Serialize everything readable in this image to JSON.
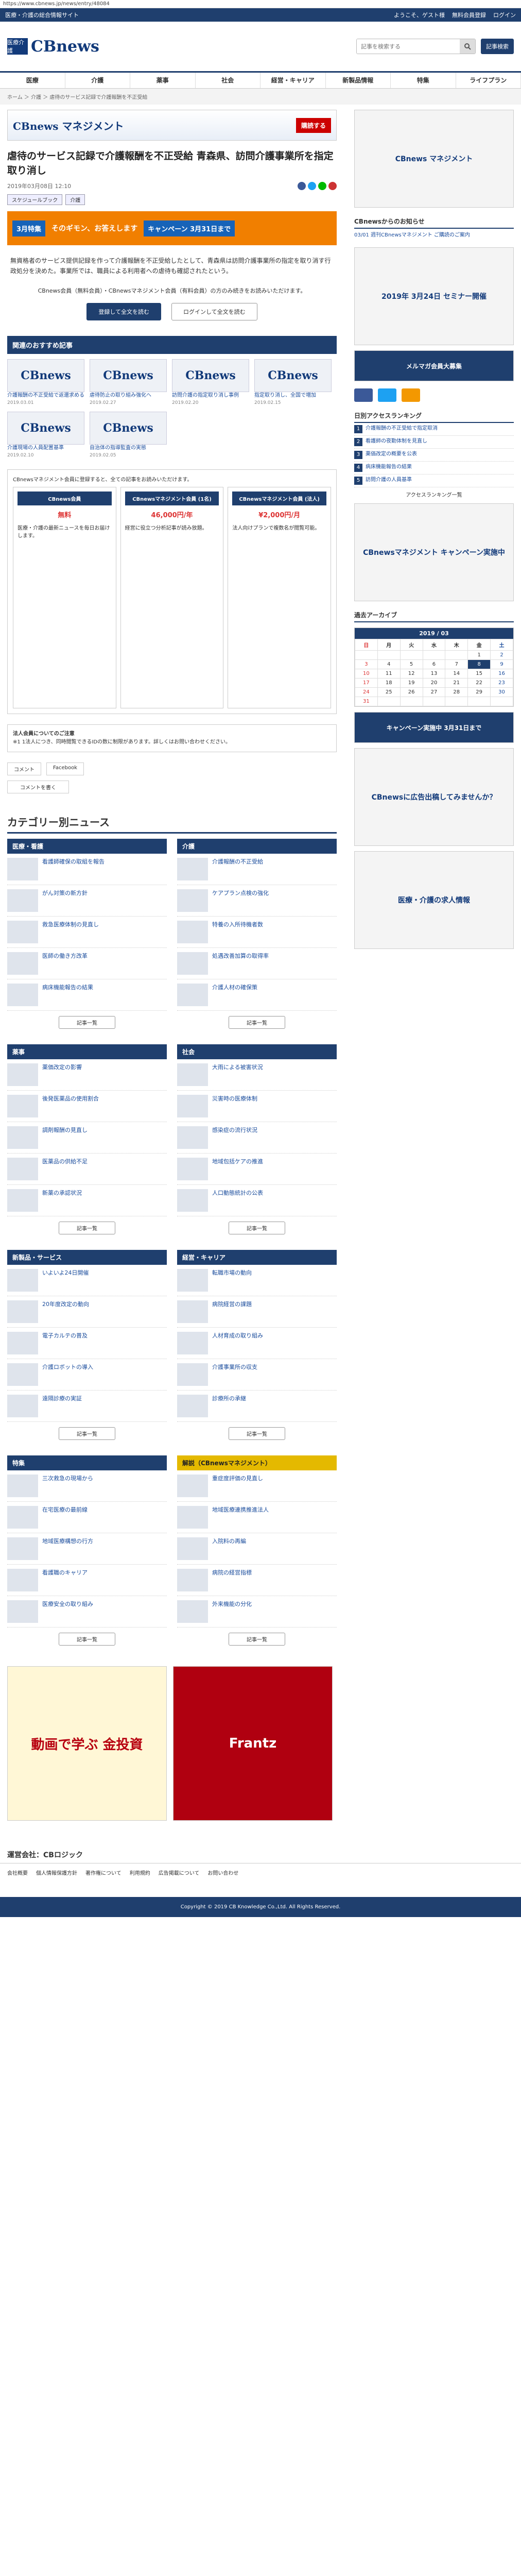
{
  "url": "https://www.cbnews.jp/news/entry/48084",
  "topbar": {
    "left": "医療・介護の総合情報サイト",
    "welcome": "ようこそ、ゲスト様",
    "trial": "無料会員登録",
    "login": "ログイン"
  },
  "logo": {
    "mark": "医療介護",
    "name": "CBnews"
  },
  "search": {
    "placeholder": "記事を検索する",
    "register": "記事検索"
  },
  "nav": [
    "医療",
    "介護",
    "薬事",
    "社会",
    "経営・キャリア",
    "新製品情報",
    "特集",
    "ライフプラン"
  ],
  "breadcrumb": "ホーム ＞ 介護 ＞ 虐待のサービス記録で介護報酬を不正受給",
  "banner": {
    "brand": "CBnews マネジメント",
    "cta": "購読する"
  },
  "article": {
    "title": "虐待のサービス記録で介護報酬を不正受給 青森県、訪問介護事業所を指定取り消し",
    "date": "2019年03月08日 12:10",
    "tags": [
      "スケジュールブック",
      "介護"
    ],
    "lead": "無資格者のサービス提供記録を作って介護報酬を不正受給したとして、青森県は訪問介護事業所の指定を取り消す行政処分を決めた。事業所では、職員による利用者への虐待も確認されたという。",
    "lock_msg": "CBnews会員（無料会員）・CBnewsマネジメント会員（有料会員）の方のみ続きをお読みいただけます。",
    "btn_register": "登録して全文を読む",
    "btn_login": "ログインして全文を読む"
  },
  "strip": {
    "left": "3月特集",
    "mid": "そのギモン、お答えします",
    "right": "キャンペーン 3月31日まで"
  },
  "related_title": "関連のおすすめ記事",
  "related": [
    {
      "label": "介護報酬の不正受給で返還求める",
      "date": "2019.03.01"
    },
    {
      "label": "虐待防止の取り組み強化へ",
      "date": "2019.02.27"
    },
    {
      "label": "訪問介護の指定取り消し事例",
      "date": "2019.02.20"
    },
    {
      "label": "指定取り消し、全国で増加",
      "date": "2019.02.15"
    },
    {
      "label": "介護現場の人員配置基準",
      "date": "2019.02.10"
    },
    {
      "label": "自治体の指導監査の実態",
      "date": "2019.02.05"
    }
  ],
  "plans": {
    "intro": "CBnewsマネジメント会員に登録すると、全ての記事をお読みいただけます。",
    "cols": [
      {
        "head": "CBnews会員",
        "price": "無料",
        "body": "医療・介護の最新ニュースを毎日お届けします。"
      },
      {
        "head": "CBnewsマネジメント会員 (1名)",
        "price": "46,000円/年",
        "body": "経営に役立つ分析記事が読み放題。"
      },
      {
        "head": "CBnewsマネジメント会員 (法人)",
        "price": "¥2,000円/月",
        "body": "法人向けプランで複数名が閲覧可能。"
      }
    ]
  },
  "notes": {
    "head": "法人会員についてのご注意",
    "body": "※1 1法人につき、同時閲覧できるIDの数に制限があります。詳しくはお問い合わせください。"
  },
  "comments": {
    "title": "コメント",
    "fb": "Facebook",
    "post": "コメントを書く"
  },
  "cat_title": "カテゴリー別ニュース",
  "cats": [
    {
      "name": "医療・看護",
      "items": [
        "看護師確保の取組を報告",
        "がん対策の新方針",
        "救急医療体制の見直し",
        "医師の働き方改革",
        "病床機能報告の結果"
      ],
      "more": "記事一覧"
    },
    {
      "name": "介護",
      "items": [
        "介護報酬の不正受給",
        "ケアプラン点検の強化",
        "特養の入所待機者数",
        "処遇改善加算の取得率",
        "介護人材の確保策"
      ],
      "more": "記事一覧"
    },
    {
      "name": "薬事",
      "items": [
        "薬価改定の影響",
        "後発医薬品の使用割合",
        "調剤報酬の見直し",
        "医薬品の供給不足",
        "新薬の承認状況"
      ],
      "more": "記事一覧"
    },
    {
      "name": "社会",
      "items": [
        "大雨による被害状況",
        "災害時の医療体制",
        "感染症の流行状況",
        "地域包括ケアの推進",
        "人口動態統計の公表"
      ],
      "more": "記事一覧"
    },
    {
      "name": "新製品・サービス",
      "items": [
        "いよいよ24日開催",
        "20年度改定の動向",
        "電子カルテの普及",
        "介護ロボットの導入",
        "遠隔診療の実証"
      ],
      "more": "記事一覧"
    },
    {
      "name": "経営・キャリア",
      "items": [
        "転職市場の動向",
        "病院経営の課題",
        "人材育成の取り組み",
        "介護事業所の収支",
        "診療所の承継"
      ],
      "more": "記事一覧"
    },
    {
      "name": "特集",
      "items": [
        "三次救急の現場から",
        "在宅医療の最前線",
        "地域医療構想の行方",
        "看護職のキャリア",
        "医療安全の取り組み"
      ],
      "more": "記事一覧"
    },
    {
      "name": "解説（CBnewsマネジメント）",
      "items": [
        "重症度評価の見直し",
        "地域医療連携推進法人",
        "入院料の再編",
        "病院の経営指標",
        "外来機能の分化"
      ],
      "more": "記事一覧"
    }
  ],
  "sidebar": {
    "news_head": "CBnewsからのお知らせ",
    "news": [
      "03/01 週刊CBnewsマネジメント ご購読のご案内"
    ],
    "ad1": "2019年 3月24日 セミナー開催",
    "ad2": "メルマガ会員大募集",
    "ranking_head": "日別アクセスランキング",
    "ranking": [
      "介護報酬の不正受給で指定取消",
      "看護師の夜勤体制を見直し",
      "薬価改定の概要を公表",
      "病床機能報告の結果",
      "訪問介護の人員基準"
    ],
    "ranking_more": "アクセスランキング一覧",
    "ad3": "CBnewsマネジメント キャンペーン実施中",
    "cal_head": "過去アーカイブ",
    "cal_month": "2019 / 03",
    "cal_days": [
      "日",
      "月",
      "火",
      "水",
      "木",
      "金",
      "土"
    ],
    "cal_rows": [
      [
        "",
        "",
        "",
        "",
        "",
        "1",
        "2"
      ],
      [
        "3",
        "4",
        "5",
        "6",
        "7",
        "8",
        "9"
      ],
      [
        "10",
        "11",
        "12",
        "13",
        "14",
        "15",
        "16"
      ],
      [
        "17",
        "18",
        "19",
        "20",
        "21",
        "22",
        "23"
      ],
      [
        "24",
        "25",
        "26",
        "27",
        "28",
        "29",
        "30"
      ],
      [
        "31",
        "",
        "",
        "",
        "",
        "",
        ""
      ]
    ],
    "cal_today": "8",
    "ad4": "キャンペーン実施中 3月31日まで",
    "ad5": "CBnewsに広告出稿してみませんか？",
    "ad6": "医療・介護の求人情報"
  },
  "bigads": {
    "left": "動画で学ぶ 金投資",
    "right": "Frantz"
  },
  "footer": {
    "company": "運営会社：CBロジック",
    "links": [
      "会社概要",
      "個人情報保護方針",
      "著作権について",
      "利用規約",
      "広告掲載について",
      "お問い合わせ"
    ],
    "copyright": "Copyright © 2019 CB Knowledge Co.,Ltd. All Rights Reserved."
  }
}
